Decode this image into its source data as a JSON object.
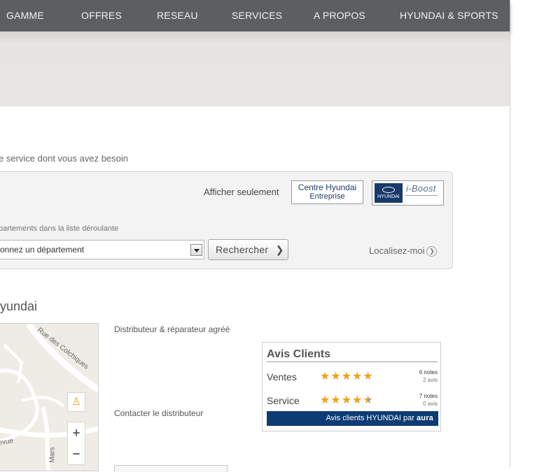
{
  "nav": {
    "items": [
      "GAMME",
      "OFFRES",
      "RESEAU",
      "SERVICES",
      "A PROPOS",
      "HYUNDAI & SPORTS"
    ]
  },
  "search": {
    "intro": "e service dont vous avez besoin",
    "show_only_label": "Afficher seulement",
    "badge_centre_line1": "Centre Hyundai",
    "badge_centre_line2": "Entreprise",
    "badge_boost_text": "i-Boost",
    "dept_hint": "partements dans la liste déroulante",
    "dept_select_value": "onnez un département",
    "search_button": "Rechercher",
    "search_button_icon": "chevron-right-icon",
    "locate_label": "Localisez-moi",
    "locate_icon": "circle-chevron-right-icon"
  },
  "dealer": {
    "title": "lyundai",
    "type": "Distributeur & réparateur agréé",
    "contact": "Contacter le distributeur",
    "map": {
      "road1": "Rue des Colchiques",
      "road2": "llevue",
      "road3": "Mars"
    }
  },
  "reviews": {
    "title": "Avis Clients",
    "rows": [
      {
        "label": "Ventes",
        "stars": "★★★★★",
        "rating": 5,
        "notes": "6 notes",
        "avis": "2 avis"
      },
      {
        "label": "Service",
        "stars": "★★★★★",
        "rating": 4.5,
        "notes": "7 notes",
        "avis": "0 avis"
      }
    ],
    "footer_text": "Avis clients HYUNDAI par",
    "footer_brand": "aura",
    "star_color": "#f0a21a"
  },
  "colors": {
    "nav_bg": "#5c5f62",
    "brand_blue": "#0d3b73"
  }
}
